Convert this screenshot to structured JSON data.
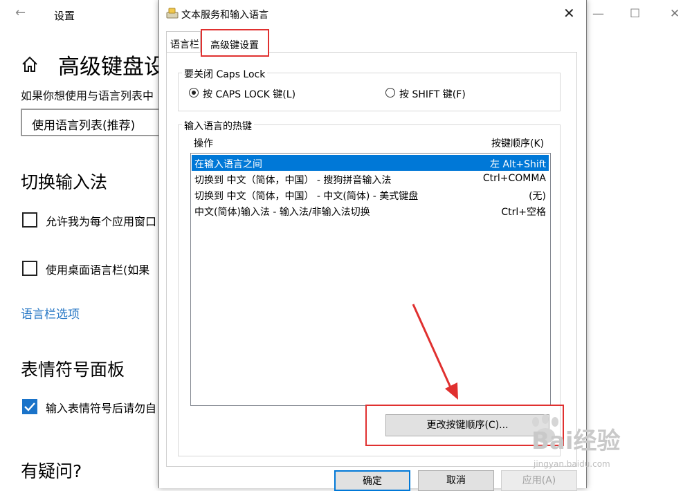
{
  "background": {
    "title": "设置",
    "heading": "高级键盘设",
    "description": "如果你想使用与语言列表中",
    "select_value": "使用语言列表(推荐)",
    "switch_heading": "切换输入法",
    "checkbox1": "允许我为每个应用窗口",
    "checkbox2": "使用桌面语言栏(如果",
    "link": "语言栏选项",
    "emoji_heading": "表情符号面板",
    "checkbox3": "输入表情符号后请勿自",
    "question": "有疑问?"
  },
  "dialog": {
    "title": "文本服务和输入语言",
    "tabs": [
      {
        "label": "语言栏",
        "active": false
      },
      {
        "label": "高级键设置",
        "active": true
      }
    ],
    "caps_group": {
      "label": "要关闭 Caps Lock",
      "option1": "按 CAPS LOCK 键(L)",
      "option2": "按 SHIFT 键(F)",
      "selected": "option1"
    },
    "hotkey_group": {
      "label": "输入语言的热键",
      "col_action": "操作",
      "col_key": "按键顺序(K)",
      "rows": [
        {
          "action": "在输入语言之间",
          "key": "左 Alt+Shift",
          "selected": true
        },
        {
          "action": "切换到 中文（简体，中国） - 搜狗拼音输入法",
          "key": "Ctrl+COMMA",
          "selected": false
        },
        {
          "action": "切换到 中文（简体，中国） - 中文(简体) - 美式键盘",
          "key": "(无)",
          "selected": false
        },
        {
          "action": "中文(简体)输入法 - 输入法/非输入法切换",
          "key": "Ctrl+空格",
          "selected": false
        }
      ],
      "change_button": "更改按键顺序(C)..."
    },
    "buttons": {
      "ok": "确定",
      "cancel": "取消",
      "apply": "应用(A)"
    }
  },
  "watermark": {
    "text": "Bai经验",
    "sub": "jingyan.baidu.com"
  },
  "colors": {
    "highlight": "#e0302f",
    "selection": "#0078d7",
    "link": "#2777c5"
  }
}
